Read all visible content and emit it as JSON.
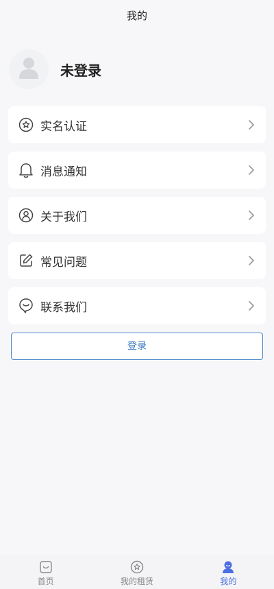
{
  "header": {
    "title": "我的"
  },
  "profile": {
    "name": "未登录"
  },
  "menu": {
    "items": [
      {
        "label": "实名认证",
        "icon": "badge-star-icon"
      },
      {
        "label": "消息通知",
        "icon": "bell-icon"
      },
      {
        "label": "关于我们",
        "icon": "user-circle-icon"
      },
      {
        "label": "常见问题",
        "icon": "edit-icon"
      },
      {
        "label": "联系我们",
        "icon": "chat-smile-icon"
      }
    ]
  },
  "login": {
    "label": "登录"
  },
  "tabbar": {
    "items": [
      {
        "label": "首页",
        "icon": "home-icon",
        "active": false
      },
      {
        "label": "我的租赁",
        "icon": "star-circle-icon",
        "active": false
      },
      {
        "label": "我的",
        "icon": "person-icon",
        "active": true
      }
    ]
  },
  "colors": {
    "accent": "#4b6fe0",
    "login_border": "#4a86c9",
    "background": "#f7f7f9"
  }
}
